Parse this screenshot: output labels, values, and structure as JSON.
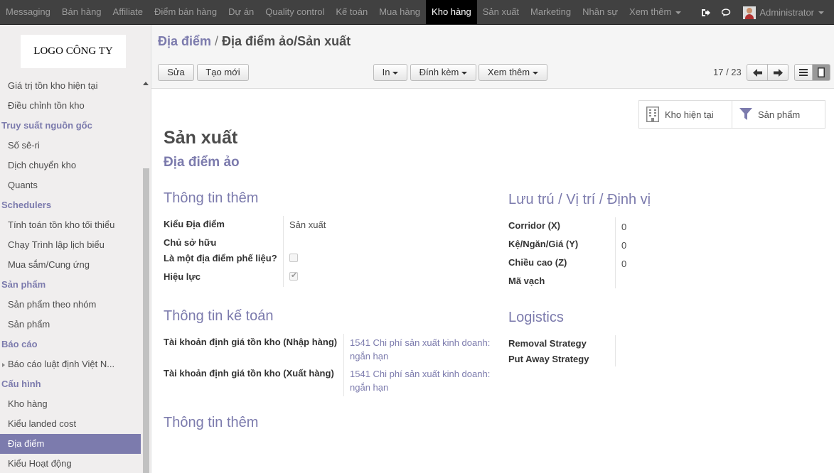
{
  "topnav": {
    "items": [
      {
        "label": "Messaging"
      },
      {
        "label": "Bán hàng"
      },
      {
        "label": "Affiliate"
      },
      {
        "label": "Điểm bán hàng"
      },
      {
        "label": "Dự án"
      },
      {
        "label": "Quality control"
      },
      {
        "label": "Kế toán"
      },
      {
        "label": "Mua hàng"
      },
      {
        "label": "Kho hàng",
        "active": true
      },
      {
        "label": "Sản xuất"
      },
      {
        "label": "Marketing"
      },
      {
        "label": "Nhân sự"
      },
      {
        "label": "Xem thêm",
        "dropdown": true
      }
    ],
    "user_name": "Administrator"
  },
  "sidebar": {
    "logo_text": "LOGO CÔNG TY",
    "entries": [
      {
        "type": "link",
        "label": "Giá trị tồn kho hiện tại"
      },
      {
        "type": "link",
        "label": "Điều chỉnh tồn kho"
      },
      {
        "type": "section",
        "label": "Truy suất nguồn gốc"
      },
      {
        "type": "link",
        "label": "Số sê-ri"
      },
      {
        "type": "link",
        "label": "Dịch chuyển kho"
      },
      {
        "type": "link",
        "label": "Quants"
      },
      {
        "type": "section",
        "label": "Schedulers"
      },
      {
        "type": "link",
        "label": "Tính toán tồn kho tối thiểu"
      },
      {
        "type": "link",
        "label": "Chạy Trình lập lịch biểu"
      },
      {
        "type": "link",
        "label": "Mua sắm/Cung ứng"
      },
      {
        "type": "section",
        "label": "Sản phẩm"
      },
      {
        "type": "link",
        "label": "Sản phẩm theo nhóm"
      },
      {
        "type": "link",
        "label": "Sản phẩm"
      },
      {
        "type": "section",
        "label": "Báo cáo"
      },
      {
        "type": "link",
        "label": "Báo cáo luật định Việt N...",
        "expandable": true
      },
      {
        "type": "section",
        "label": "Cấu hình"
      },
      {
        "type": "link",
        "label": "Kho hàng"
      },
      {
        "type": "link",
        "label": "Kiểu landed cost"
      },
      {
        "type": "link",
        "label": "Địa điểm",
        "active": true
      },
      {
        "type": "link",
        "label": "Kiểu Hoạt động"
      }
    ]
  },
  "breadcrumb": {
    "parent": "Địa điểm",
    "separator": "/",
    "current": "Địa điểm ảo/Sản xuất"
  },
  "toolbar": {
    "edit_label": "Sửa",
    "create_label": "Tạo mới",
    "print_label": "In",
    "attach_label": "Đính kèm",
    "more_label": "Xem thêm"
  },
  "pager": {
    "value": "17 / 23"
  },
  "smart_buttons": {
    "current_stock": "Kho hiện tại",
    "products": "Sản phẩm"
  },
  "form": {
    "title": "Sản xuất",
    "subtitle": "Địa điểm ảo",
    "section_additional": "Thông tin thêm",
    "location_type_label": "Kiểu Địa điểm",
    "location_type_value": "Sản xuất",
    "owner_label": "Chủ sở hữu",
    "scrap_label": "Là một địa điểm phế liệu?",
    "scrap_checked": false,
    "active_label": "Hiệu lực",
    "active_checked": true,
    "section_localization": "Lưu trú / Vị trí / Định vị",
    "corridor_label": "Corridor (X)",
    "corridor_value": "0",
    "shelf_label": "Kệ/Ngăn/Giá (Y)",
    "shelf_value": "0",
    "height_label": "Chiều cao (Z)",
    "height_value": "0",
    "barcode_label": "Mã vạch",
    "section_accounting": "Thông tin kế toán",
    "valuation_in_label": "Tài khoản định giá tồn kho (Nhập hàng)",
    "valuation_in_value": "1541 Chi phí sản xuất kinh doanh: ngắn hạn",
    "valuation_out_label": "Tài khoản định giá tồn kho (Xuất hàng)",
    "valuation_out_value": "1541 Chi phí sản xuất kinh doanh: ngắn hạn",
    "section_logistics": "Logistics",
    "removal_label": "Removal Strategy",
    "putaway_label": "Put Away Strategy",
    "section_additional_2": "Thông tin thêm"
  }
}
